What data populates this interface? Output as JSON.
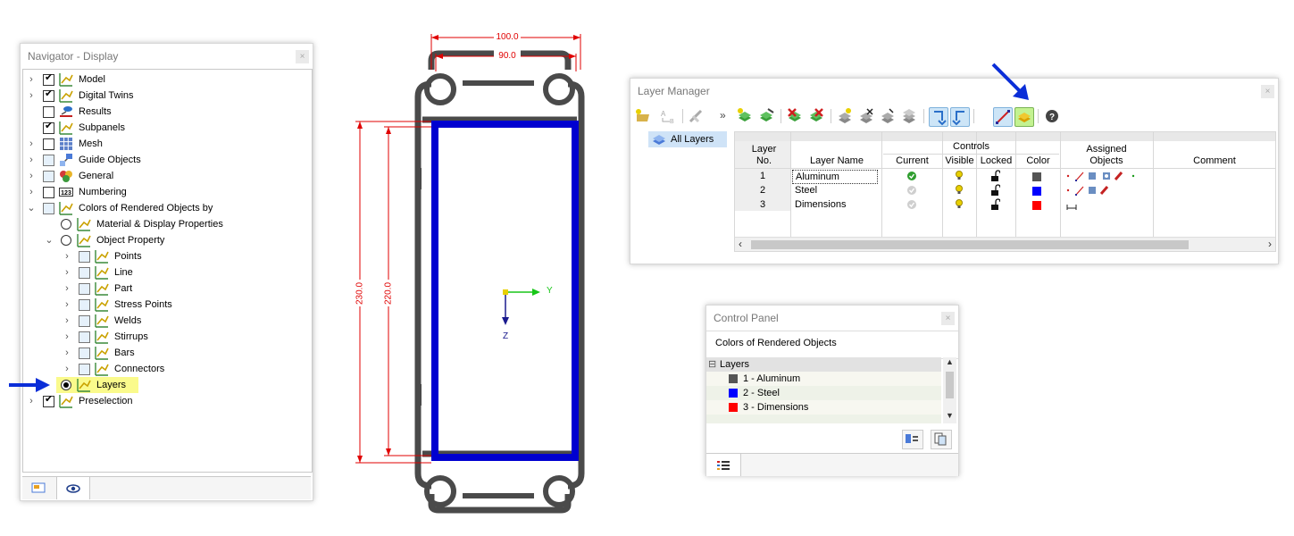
{
  "navigator": {
    "title": "Navigator - Display",
    "close": "×",
    "items": [
      {
        "label": "Model"
      },
      {
        "label": "Digital Twins"
      },
      {
        "label": "Results"
      },
      {
        "label": "Subpanels"
      },
      {
        "label": "Mesh"
      },
      {
        "label": "Guide Objects"
      },
      {
        "label": "General"
      },
      {
        "label": "Numbering"
      },
      {
        "label": "Colors of Rendered Objects by"
      },
      {
        "label": "Material & Display Properties"
      },
      {
        "label": "Object Property"
      },
      {
        "label": "Points"
      },
      {
        "label": "Line"
      },
      {
        "label": "Part"
      },
      {
        "label": "Stress Points"
      },
      {
        "label": "Welds"
      },
      {
        "label": "Stirrups"
      },
      {
        "label": "Bars"
      },
      {
        "label": "Connectors"
      },
      {
        "label": "Layers"
      },
      {
        "label": "Preselection"
      }
    ]
  },
  "drawing": {
    "dim_width_outer": "100.0",
    "dim_width_inner": "90.0",
    "dim_height_outer": "230.0",
    "dim_height_inner": "220.0",
    "axis_y": "Y",
    "axis_z": "Z"
  },
  "layer_manager": {
    "title": "Layer Manager",
    "close": "×",
    "more": "»",
    "tree_item": "All Layers",
    "headers": {
      "layer_no": "Layer No.",
      "layer_name": "Layer Name",
      "controls": "Controls",
      "current": "Current",
      "visible": "Visible",
      "locked": "Locked",
      "color": "Color",
      "assigned": "Assigned Objects",
      "comment": "Comment"
    },
    "rows": [
      {
        "no": "1",
        "name": "Aluminum",
        "color": "#555555",
        "current": true
      },
      {
        "no": "2",
        "name": "Steel",
        "color": "#0000ff",
        "current": false
      },
      {
        "no": "3",
        "name": "Dimensions",
        "color": "#ff0000",
        "current": false
      }
    ]
  },
  "control_panel": {
    "title": "Control Panel",
    "close": "×",
    "heading": "Colors of Rendered Objects",
    "group": "Layers",
    "expander": "⊟",
    "legend": [
      {
        "label": "1 - Aluminum",
        "color": "#555555"
      },
      {
        "label": "2 - Steel",
        "color": "#0000ff"
      },
      {
        "label": "3 - Dimensions",
        "color": "#ff0000"
      }
    ]
  }
}
